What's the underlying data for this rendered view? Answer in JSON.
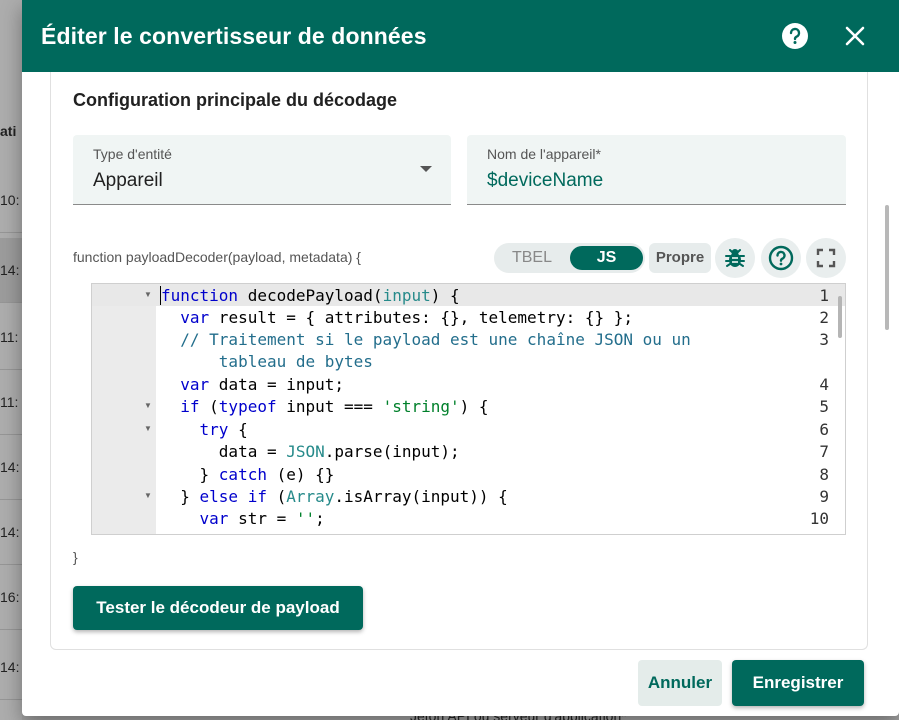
{
  "background": {
    "column_header": "ati",
    "rows": [
      "10:",
      "14:",
      "11:",
      "11:",
      "14:",
      "14:",
      "16:",
      "14:"
    ],
    "bottom_text": "Jeton API ou serveur d'application*"
  },
  "dialog": {
    "title": "Éditer le convertisseur de données",
    "help_icon": "help-circle-icon",
    "close_icon": "close-icon"
  },
  "section": {
    "title": "Configuration principale du décodage"
  },
  "entity_type": {
    "label": "Type d'entité",
    "value": "Appareil"
  },
  "device_name": {
    "label": "Nom de l'appareil*",
    "value": "$deviceName"
  },
  "function_signature": "function payloadDecoder(payload, metadata) {",
  "function_close": "}",
  "language_toggle": {
    "options": [
      "TBEL",
      "JS"
    ],
    "selected": "JS"
  },
  "custom_button": "Propre",
  "editor_buttons": [
    "bug-icon",
    "help-circle-icon",
    "fullscreen-icon"
  ],
  "editor": {
    "line_numbers": [
      "1",
      "2",
      "3",
      "4",
      "5",
      "6",
      "7",
      "8",
      "9",
      "10"
    ],
    "lines": [
      "function decodePayload(input) {",
      "  var result = { attributes: {}, telemetry: {} };",
      "  // Traitement si le payload est une chaîne JSON ou un",
      "      tableau de bytes",
      "  var data = input;",
      "  if (typeof input === 'string') {",
      "    try {",
      "      data = JSON.parse(input);",
      "    } catch (e) {}",
      "  } else if (Array.isArray(input)) {",
      "    var str = '';"
    ]
  },
  "test_button": "Tester le décodeur de payload",
  "footer": {
    "cancel": "Annuler",
    "save": "Enregistrer"
  },
  "colors": {
    "primary": "#00695c",
    "field_bg": "#f0f5f4",
    "keyword": "#0000cc",
    "comment": "#236e8c",
    "string": "#00802b"
  }
}
